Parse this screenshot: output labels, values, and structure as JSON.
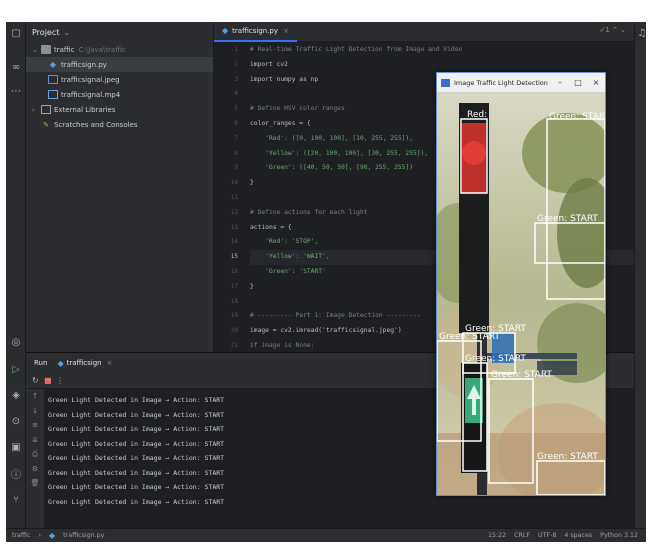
{
  "project": {
    "header": "Project",
    "tree": [
      {
        "label": "traffic",
        "hint": "C:\\Java\\traffic",
        "type": "folder",
        "depth": 0
      },
      {
        "label": "trafficsign.py",
        "type": "py",
        "depth": 1,
        "selected": true
      },
      {
        "label": "trafficsignal.jpeg",
        "type": "image",
        "depth": 1
      },
      {
        "label": "trafficsignal.mp4",
        "type": "video",
        "depth": 1
      },
      {
        "label": "External Libraries",
        "type": "library",
        "depth": 0
      },
      {
        "label": "Scratches and Consoles",
        "type": "scratch",
        "depth": 0
      }
    ]
  },
  "editor": {
    "tab": "trafficsign.py",
    "gutter_numbers": [
      "1",
      "2",
      "3",
      "4",
      "5",
      "6",
      "7",
      "8",
      "9",
      "10",
      "11",
      "12",
      "13",
      "14",
      "15",
      "16",
      "17",
      "18",
      "19",
      "20",
      "21"
    ],
    "highlight_line": 15,
    "lines": [
      {
        "cls": "cm",
        "text": "# Real-time Traffic Light Detection from Image and Video"
      },
      {
        "cls": "",
        "text": "import cv2"
      },
      {
        "cls": "",
        "text": "import numpy as np"
      },
      {
        "cls": "",
        "text": ""
      },
      {
        "cls": "cm",
        "text": "# Define HSV color ranges"
      },
      {
        "cls": "",
        "text": "color_ranges = {"
      },
      {
        "cls": "st",
        "text": "    'Red': ([0, 100, 100], [10, 255, 255]),"
      },
      {
        "cls": "st",
        "text": "    'Yellow': ([20, 100, 100], [30, 255, 255]),"
      },
      {
        "cls": "st",
        "text": "    'Green': ([40, 50, 50], [90, 255, 255])"
      },
      {
        "cls": "",
        "text": "}"
      },
      {
        "cls": "",
        "text": ""
      },
      {
        "cls": "cm",
        "text": "# Define actions for each light"
      },
      {
        "cls": "",
        "text": "actions = {"
      },
      {
        "cls": "st",
        "text": "    'Red': 'STOP',"
      },
      {
        "cls": "st",
        "text": "    'Yellow': 'WAIT',"
      },
      {
        "cls": "st",
        "text": "    'Green': 'START'"
      },
      {
        "cls": "",
        "text": "}"
      },
      {
        "cls": "",
        "text": ""
      },
      {
        "cls": "cm",
        "text": "# --------- Part 1: Image Detection ---------"
      },
      {
        "cls": "",
        "text": "image = cv2.imread('trafficsignal.jpeg')"
      },
      {
        "cls": "cm",
        "text": "if image is None:"
      }
    ]
  },
  "run": {
    "label": "Run",
    "tab": "trafficsign",
    "output": [
      "Green Light Detected in Image → Action: START",
      "Green Light Detected in Image → Action: START",
      "Green Light Detected in Image → Action: START",
      "Green Light Detected in Image → Action: START",
      "Green Light Detected in Image → Action: START",
      "Green Light Detected in Image → Action: START",
      "Green Light Detected in Image → Action: START",
      "Green Light Detected in Image → Action: START"
    ]
  },
  "status": {
    "breadcrumb_root": "traffic",
    "breadcrumb_file": "trafficsign.py",
    "position": "15:22",
    "line_sep": "CRLF",
    "encoding": "UTF-8",
    "indent": "4 spaces",
    "interpreter": "Python 3.12"
  },
  "cv_window": {
    "title": "Image Traffic Light Detection",
    "detections": [
      {
        "label": "Red:"
      },
      {
        "label": "Green: START"
      },
      {
        "label": "Green: START"
      },
      {
        "label": "Green: START"
      },
      {
        "label": "Green: START"
      },
      {
        "label": "Green: START"
      },
      {
        "label": "Green: START"
      },
      {
        "label": "Green: START"
      }
    ]
  },
  "colors": {
    "ide_bg": "#1e1f22",
    "panel_bg": "#2b2d30",
    "accent": "#3574f0",
    "detection_box": "#ffffff"
  }
}
